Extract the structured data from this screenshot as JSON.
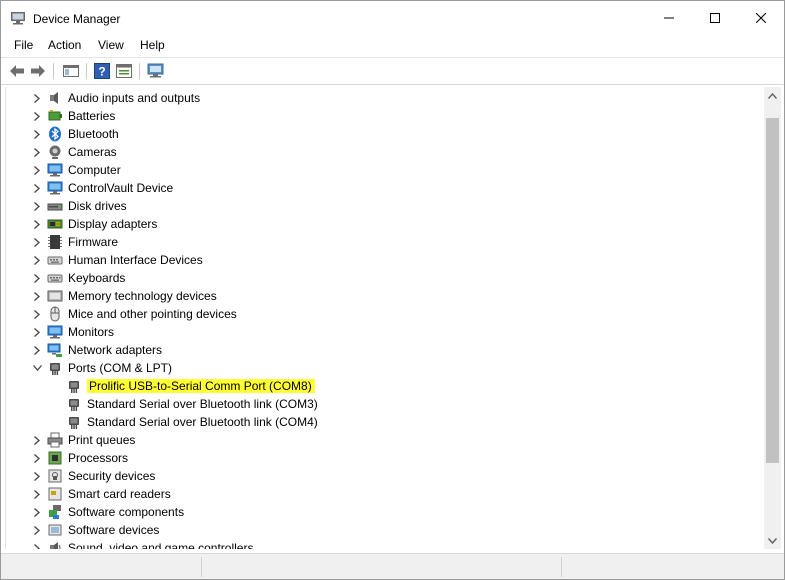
{
  "window": {
    "title": "Device Manager"
  },
  "menu": [
    "File",
    "Action",
    "View",
    "Help"
  ],
  "tree": {
    "items": [
      {
        "label": "Audio inputs and outputs",
        "icon": "speaker-icon"
      },
      {
        "label": "Batteries",
        "icon": "battery-icon"
      },
      {
        "label": "Bluetooth",
        "icon": "bluetooth-icon"
      },
      {
        "label": "Cameras",
        "icon": "camera-icon"
      },
      {
        "label": "Computer",
        "icon": "computer-icon"
      },
      {
        "label": "ControlVault Device",
        "icon": "monitor-icon"
      },
      {
        "label": "Disk drives",
        "icon": "disk-drive-icon"
      },
      {
        "label": "Display adapters",
        "icon": "display-adapter-icon"
      },
      {
        "label": "Firmware",
        "icon": "firmware-icon"
      },
      {
        "label": "Human Interface Devices",
        "icon": "hid-icon"
      },
      {
        "label": "Keyboards",
        "icon": "keyboard-icon"
      },
      {
        "label": "Memory technology devices",
        "icon": "memory-icon"
      },
      {
        "label": "Mice and other pointing devices",
        "icon": "mouse-icon"
      },
      {
        "label": "Monitors",
        "icon": "monitor-icon"
      },
      {
        "label": "Network adapters",
        "icon": "network-icon"
      },
      {
        "label": "Ports (COM & LPT)",
        "icon": "port-icon",
        "expanded": true
      },
      {
        "label": "Prolific USB-to-Serial Comm Port (COM8)",
        "icon": "port-icon",
        "child": true,
        "highlighted": true
      },
      {
        "label": "Standard Serial over Bluetooth link (COM3)",
        "icon": "port-icon",
        "child": true
      },
      {
        "label": "Standard Serial over Bluetooth link (COM4)",
        "icon": "port-icon",
        "child": true
      },
      {
        "label": "Print queues",
        "icon": "printer-icon"
      },
      {
        "label": "Processors",
        "icon": "processor-icon"
      },
      {
        "label": "Security devices",
        "icon": "security-icon"
      },
      {
        "label": "Smart card readers",
        "icon": "smart-card-icon"
      },
      {
        "label": "Software components",
        "icon": "software-component-icon"
      },
      {
        "label": "Software devices",
        "icon": "software-device-icon"
      },
      {
        "label": "Sound, video and game controllers",
        "icon": "sound-icon"
      }
    ]
  },
  "colors": {
    "highlight": "#ffff33",
    "accent": "#1f6fd1"
  }
}
